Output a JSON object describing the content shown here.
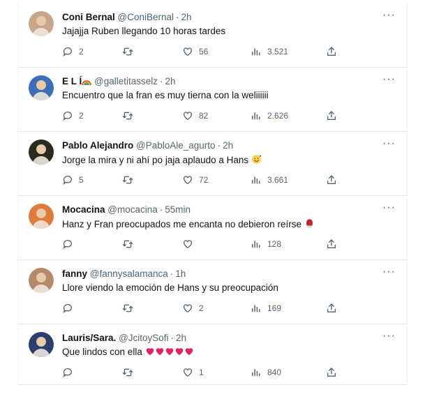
{
  "tweets": [
    {
      "name": "Coni Bernal",
      "handle": "@ConiBernal",
      "time": "2h",
      "text": "Jajajja Ruben llegando 10 horas tardes",
      "replies": "2",
      "retweets": "",
      "likes": "56",
      "views": "3.521",
      "avatar_color": "#c9a58c"
    },
    {
      "name": "E L Í",
      "handle": "@galletitasselz",
      "time": "2h",
      "text": "Encuentro que la fran es muy tierna con la weliiiiii",
      "replies": "2",
      "retweets": "",
      "likes": "82",
      "views": "2.626",
      "avatar_color": "#3d6fb8"
    },
    {
      "name": "Pablo Alejandro",
      "handle": "@PabloAle_agurto",
      "time": "2h",
      "text": "Jorge la mira y ni ahí po jaja aplaudo a Hans",
      "replies": "5",
      "retweets": "",
      "likes": "72",
      "views": "3.661",
      "avatar_color": "#2a2a1e"
    },
    {
      "name": "Mocacina",
      "handle": "@mocacina",
      "time": "55min",
      "text": "Hanz y Fran preocupados me encanta no debieron reírse",
      "replies": "",
      "retweets": "",
      "likes": "",
      "views": "128",
      "avatar_color": "#e07a3a"
    },
    {
      "name": "fanny",
      "handle": "@fannysalamanca",
      "time": "1h",
      "text": "Llore viendo la emoción de Hans y su preocupación",
      "replies": "",
      "retweets": "",
      "likes": "2",
      "views": "169",
      "avatar_color": "#b58a6a"
    },
    {
      "name": "Lauris/Sara.",
      "handle": "@JcitoySofi",
      "time": "2h",
      "text": "Que lindos con ella",
      "replies": "",
      "retweets": "",
      "likes": "1",
      "views": "840",
      "avatar_color": "#2c3e6e"
    }
  ],
  "separator": "·",
  "more_label": "···",
  "icons": {
    "reply": "reply-icon",
    "retweet": "retweet-icon",
    "like": "heart-icon",
    "views": "views-icon",
    "share": "share-icon",
    "more": "more-icon"
  },
  "colors": {
    "text": "#0f1419",
    "muted": "#536471",
    "heart_emoji": "#e0245e"
  }
}
